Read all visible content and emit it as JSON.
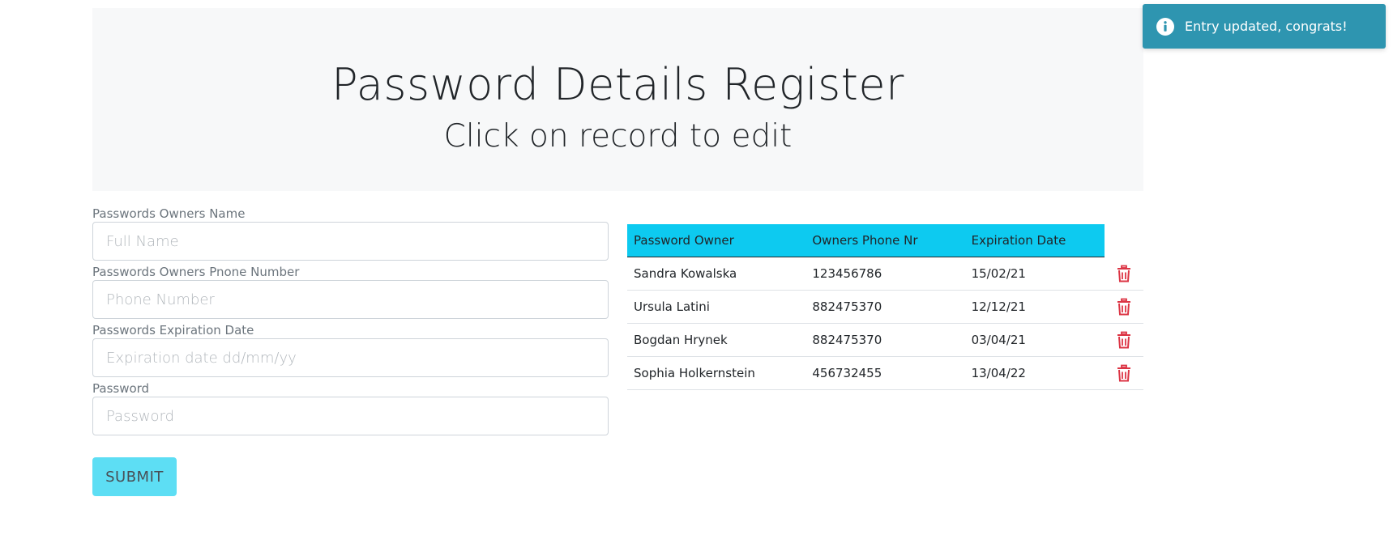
{
  "header": {
    "title": "Password Details Register",
    "subtitle": "Click on record to edit"
  },
  "form": {
    "fields": [
      {
        "label": "Passwords Owners Name",
        "placeholder": "Full Name",
        "value": ""
      },
      {
        "label": "Passwords Owners Pnone Number",
        "placeholder": "Phone Number",
        "value": ""
      },
      {
        "label": "Passwords Expiration Date",
        "placeholder": "Expiration date dd/mm/yy",
        "value": ""
      },
      {
        "label": "Password",
        "placeholder": "Password",
        "value": ""
      }
    ],
    "submit_label": "SUBMIT"
  },
  "table": {
    "headers": [
      "Password Owner",
      "Owners Phone Nr",
      "Expiration Date"
    ],
    "rows": [
      [
        "Sandra Kowalska",
        "123456786",
        "15/02/21"
      ],
      [
        "Ursula Latini",
        "882475370",
        "12/12/21"
      ],
      [
        "Bogdan Hrynek",
        "882475370",
        "03/04/21"
      ],
      [
        "Sophia Holkernstein",
        "456732455",
        "13/04/22"
      ]
    ],
    "row_action_icon": "trash-icon"
  },
  "toast": {
    "message": "Entry updated, congrats!",
    "icon": "info-icon"
  },
  "colors": {
    "jumbotron_bg": "#f7f8f9",
    "table_header_bg": "#0dcaf0",
    "submit_bg": "#5ddef4",
    "toast_bg": "#2e95b0",
    "delete_red": "#dc3545"
  }
}
